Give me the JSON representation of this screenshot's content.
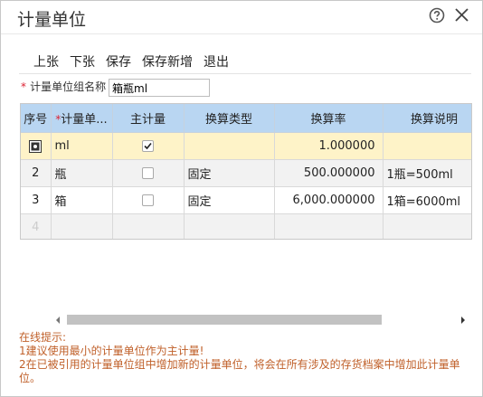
{
  "dialog": {
    "title": "计量单位"
  },
  "toolbar": {
    "prev": "上张",
    "next": "下张",
    "save": "保存",
    "save_new": "保存新增",
    "exit": "退出"
  },
  "group_field": {
    "required_mark": "*",
    "label": "计量单位组名称",
    "value": "箱瓶ml"
  },
  "table": {
    "headers": {
      "seq": "序号",
      "unit_required": "*",
      "unit": "计量单...",
      "main": "主计量",
      "conv_type": "换算类型",
      "rate": "换算率",
      "desc": "换算说明"
    },
    "rows": [
      {
        "seq": "",
        "unit": "ml",
        "main": true,
        "conv_type": "",
        "rate": "1.000000",
        "desc": ""
      },
      {
        "seq": "2",
        "unit": "瓶",
        "main": false,
        "conv_type": "固定",
        "rate": "500.000000",
        "desc": "1瓶=500ml"
      },
      {
        "seq": "3",
        "unit": "箱",
        "main": false,
        "conv_type": "固定",
        "rate": "6,000.000000",
        "desc": "1箱=6000ml"
      },
      {
        "seq": "4",
        "unit": "",
        "main": null,
        "conv_type": "",
        "rate": "",
        "desc": ""
      }
    ]
  },
  "notice": {
    "head": "在线提示:",
    "line1": "1建议使用最小的计量单位作为主计量!",
    "line2": "2在已被引用的计量单位组中增加新的计量单位，将会在所有涉及的存货档案中增加此计量单位。"
  },
  "colors": {
    "header_bg": "#b9d6f2",
    "selected_row": "#fef3c8",
    "notice_text": "#c0602a",
    "required": "#dd2233"
  }
}
